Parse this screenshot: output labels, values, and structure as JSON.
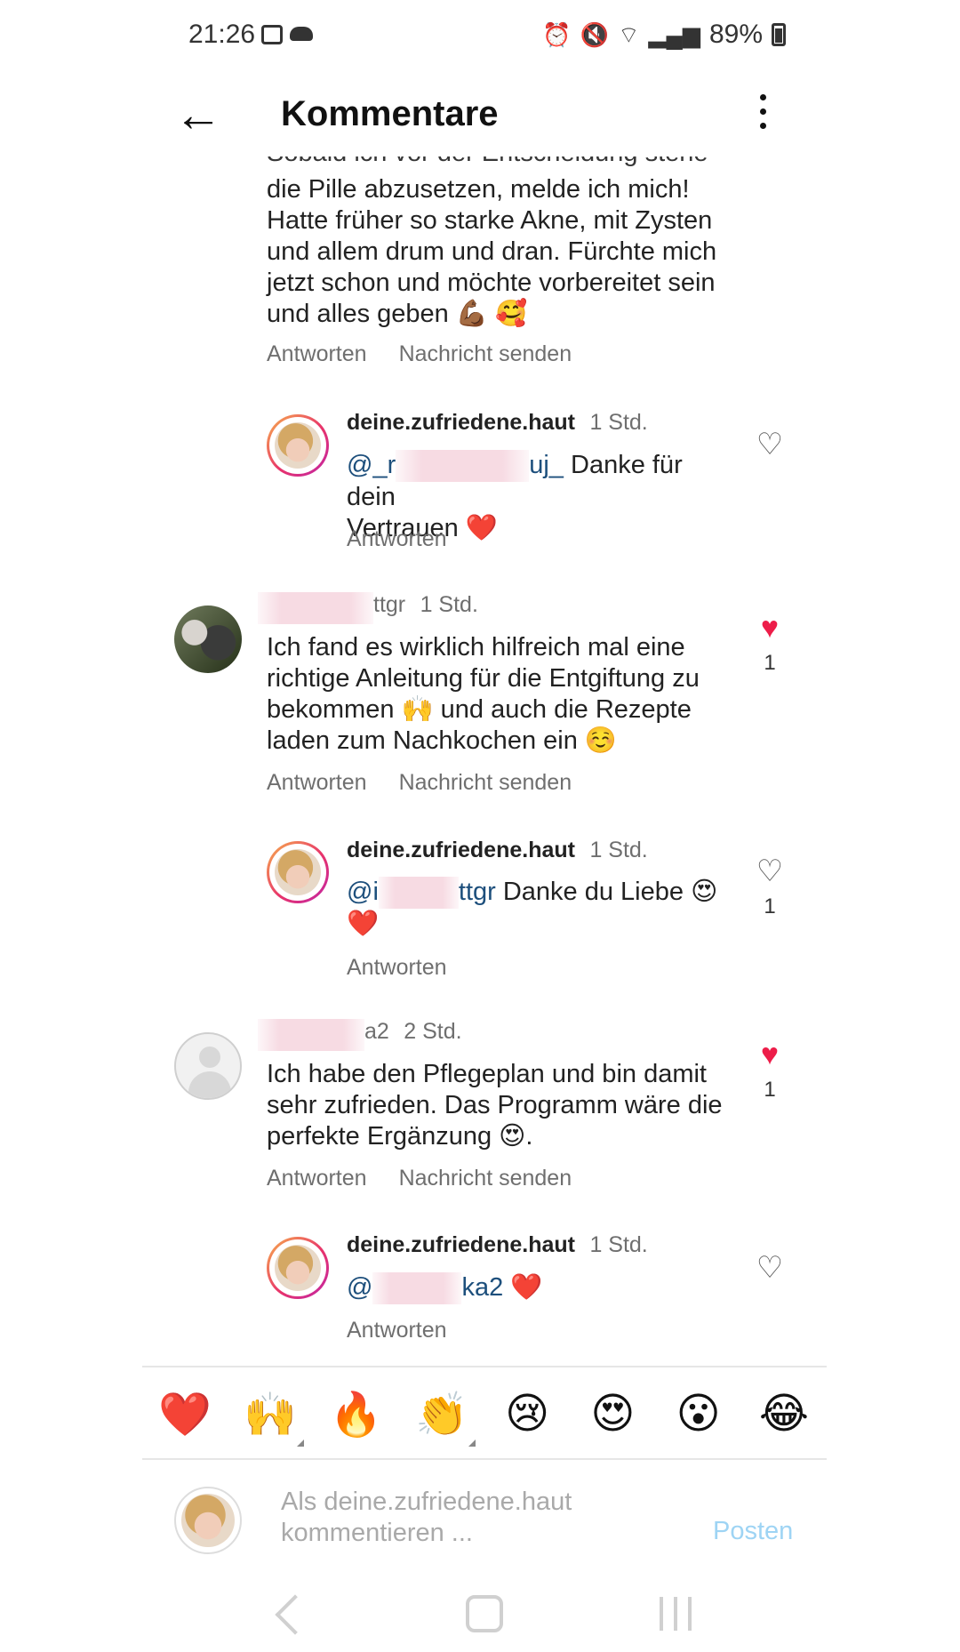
{
  "status_bar": {
    "time": "21:26",
    "battery": "89%",
    "icons": [
      "gallery-icon",
      "cloud-icon",
      "alarm-icon",
      "mute-icon",
      "wifi-icon",
      "signal-icon",
      "battery-icon"
    ]
  },
  "header": {
    "title": "Kommentare"
  },
  "feed": {
    "cut_top_line": "Sobald ich vor der Entscheidung stehe",
    "first_comment_text": "die Pille abzusetzen, melde ich mich! Hatte früher so starke Akne, mit Zysten und allem drum und dran. Fürchte mich jetzt schon und möchte vorbereitet sein und alles geben 💪🏾 🥰",
    "reply_label": "Antworten",
    "message_label": "Nachricht senden",
    "items": [
      {
        "user": "deine.zufriedene.haut",
        "time": "1 Std.",
        "mention_start": "@_r",
        "mention_end": "uj_",
        "text": " Danke für dein",
        "text2": "Vertrauen ❤️",
        "likes": ""
      },
      {
        "user_tail": "ttgr",
        "time": "1 Std.",
        "text": "Ich fand es wirklich hilfreich mal eine richtige Anleitung für die Entgiftung zu bekommen 🙌 und auch die Rezepte laden zum Nachkochen ein ☺️",
        "likes": "1"
      },
      {
        "user": "deine.zufriedene.haut",
        "time": "1 Std.",
        "mention_start": "@i",
        "mention_end": "ttgr",
        "text": " Danke du Liebe 😍",
        "text2": "❤️",
        "likes": "1"
      },
      {
        "user_tail": "a2",
        "time": "2 Std.",
        "text": "Ich habe den Pflegeplan und bin damit sehr zufrieden. Das Programm wäre die perfekte Ergänzung 😍.",
        "likes": "1"
      },
      {
        "user": "deine.zufriedene.haut",
        "time": "1 Std.",
        "mention_start": "@",
        "mention_end": "ka2",
        "text": " ❤️",
        "likes": ""
      }
    ]
  },
  "emoji_bar": [
    "❤️",
    "🙌",
    "🔥",
    "👏",
    "😢",
    "😍",
    "😮",
    "😂"
  ],
  "composer": {
    "placeholder": "Als deine.zufriedene.haut kommentieren ...",
    "post_label": "Posten"
  },
  "colors": {
    "like_red": "#ed1d49",
    "post_blue": "#9ed4f4",
    "mention": "#1d4f7c"
  }
}
